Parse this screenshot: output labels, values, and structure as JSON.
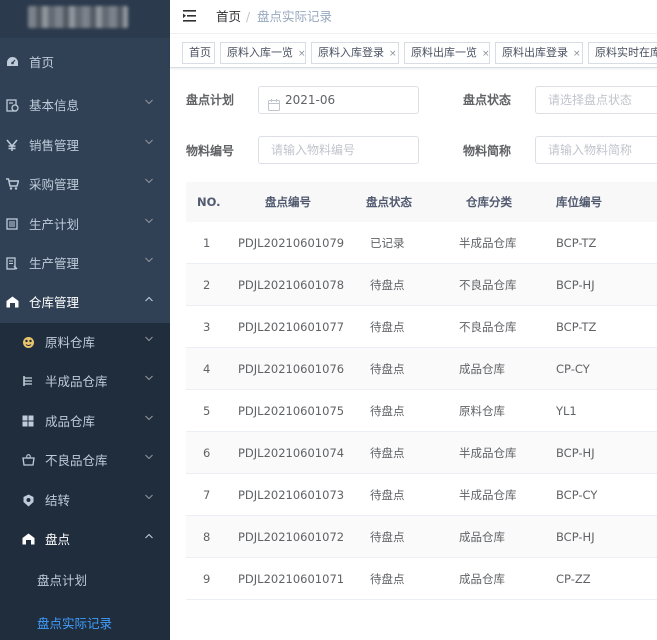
{
  "sidebar": {
    "menu": [
      {
        "label": "首页",
        "icon": "dashboard-icon",
        "arrow": false
      },
      {
        "label": "基本信息",
        "icon": "info-icon",
        "arrow": true
      },
      {
        "label": "销售管理",
        "icon": "yen-icon",
        "arrow": true
      },
      {
        "label": "采购管理",
        "icon": "cart-icon",
        "arrow": true
      },
      {
        "label": "生产计划",
        "icon": "plan-icon",
        "arrow": true
      },
      {
        "label": "生产管理",
        "icon": "production-icon",
        "arrow": true
      },
      {
        "label": "仓库管理",
        "icon": "warehouse-icon",
        "arrow": true
      }
    ],
    "warehouse_submenu": [
      {
        "label": "原料仓库",
        "icon": "raw-material-icon"
      },
      {
        "label": "半成品仓库",
        "icon": "semi-finished-icon"
      },
      {
        "label": "成品仓库",
        "icon": "finished-icon"
      },
      {
        "label": "不良品仓库",
        "icon": "defective-icon"
      },
      {
        "label": "结转",
        "icon": "carryover-icon"
      },
      {
        "label": "盘点",
        "icon": "inventory-icon"
      }
    ],
    "inventory_children": [
      {
        "label": "盘点计划"
      },
      {
        "label": "盘点实际记录"
      }
    ]
  },
  "header": {
    "breadcrumb_home": "首页",
    "breadcrumb_separator": "/",
    "breadcrumb_current": "盘点实际记录"
  },
  "tags": [
    {
      "label": "首页",
      "closable": false
    },
    {
      "label": "原料入库一览",
      "closable": true
    },
    {
      "label": "原料入库登录",
      "closable": true
    },
    {
      "label": "原料出库一览",
      "closable": true
    },
    {
      "label": "原料出库登录",
      "closable": true
    },
    {
      "label": "原料实时在库",
      "closable": false
    }
  ],
  "tag_close_glyph": "×",
  "form": {
    "plan_label": "盘点计划",
    "plan_value": "2021-06",
    "status_label": "盘点状态",
    "status_placeholder": "请选择盘点状态",
    "material_no_label": "物料编号",
    "material_no_placeholder": "请输入物料编号",
    "material_abbr_label": "物料简称",
    "material_abbr_placeholder": "请输入物料简称"
  },
  "table": {
    "columns": [
      "NO.",
      "盘点编号",
      "盘点状态",
      "仓库分类",
      "库位编号"
    ],
    "rows": [
      [
        "1",
        "PDJL20210601079",
        "已记录",
        "半成品仓库",
        "BCP-TZ"
      ],
      [
        "2",
        "PDJL20210601078",
        "待盘点",
        "不良品仓库",
        "BCP-HJ"
      ],
      [
        "3",
        "PDJL20210601077",
        "待盘点",
        "不良品仓库",
        "BCP-TZ"
      ],
      [
        "4",
        "PDJL20210601076",
        "待盘点",
        "成品仓库",
        "CP-CY"
      ],
      [
        "5",
        "PDJL20210601075",
        "待盘点",
        "原料仓库",
        "YL1"
      ],
      [
        "6",
        "PDJL20210601074",
        "待盘点",
        "半成品仓库",
        "BCP-HJ"
      ],
      [
        "7",
        "PDJL20210601073",
        "待盘点",
        "半成品仓库",
        "BCP-CY"
      ],
      [
        "8",
        "PDJL20210601072",
        "待盘点",
        "成品仓库",
        "BCP-HJ"
      ],
      [
        "9",
        "PDJL20210601071",
        "待盘点",
        "成品仓库",
        "CP-ZZ"
      ]
    ]
  },
  "colors": {
    "sidebar_bg": "#304156",
    "submenu_bg": "#1f2d3d",
    "accent": "#409eff"
  }
}
